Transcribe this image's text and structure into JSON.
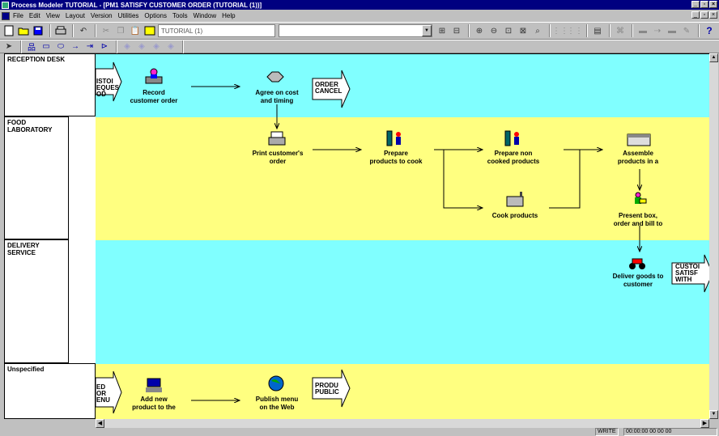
{
  "window": {
    "title": "Process Modeler TUTORIAL - [PM1 SATISFY CUSTOMER ORDER (TUTORIAL (1))]"
  },
  "menu": [
    "File",
    "Edit",
    "View",
    "Layout",
    "Version",
    "Utilities",
    "Options",
    "Tools",
    "Window",
    "Help"
  ],
  "toolbar": {
    "model_combo": "TUTORIAL (1)",
    "help_label": "?"
  },
  "lanes": [
    {
      "label": "RECEPTION DESK"
    },
    {
      "label": "FOOD LABORATORY"
    },
    {
      "label": "DELIVERY SERVICE"
    },
    {
      "label": "Unspecified"
    }
  ],
  "process": {
    "reception_in": "ISTOI\nEQUES\nOD",
    "record_order": "Record\ncustomer order",
    "agree_cost": "Agree on cost\nand timing",
    "order_cancel": "ORDER\nCANCEL",
    "print_order": "Print customer's\norder",
    "prepare_cook": "Prepare\nproducts to cook",
    "prepare_noncooked": "Prepare non\ncooked products",
    "assemble": "Assemble\nproducts in a",
    "cook_products": "Cook products",
    "present_box": "Present box,\norder and bill to",
    "deliver_goods": "Deliver goods to\ncustomer",
    "customer_out": "CUSTOI\nSATISF\nWITH",
    "unspec_in": "ED\nOR\nENU",
    "add_product": "Add new\nproduct to the",
    "publish_menu": "Publish menu\non the Web",
    "product_public": "PRODU\nPUBLIC"
  },
  "status": {
    "mode": "WRITE",
    "time": "00:00:00 00 00 00"
  }
}
